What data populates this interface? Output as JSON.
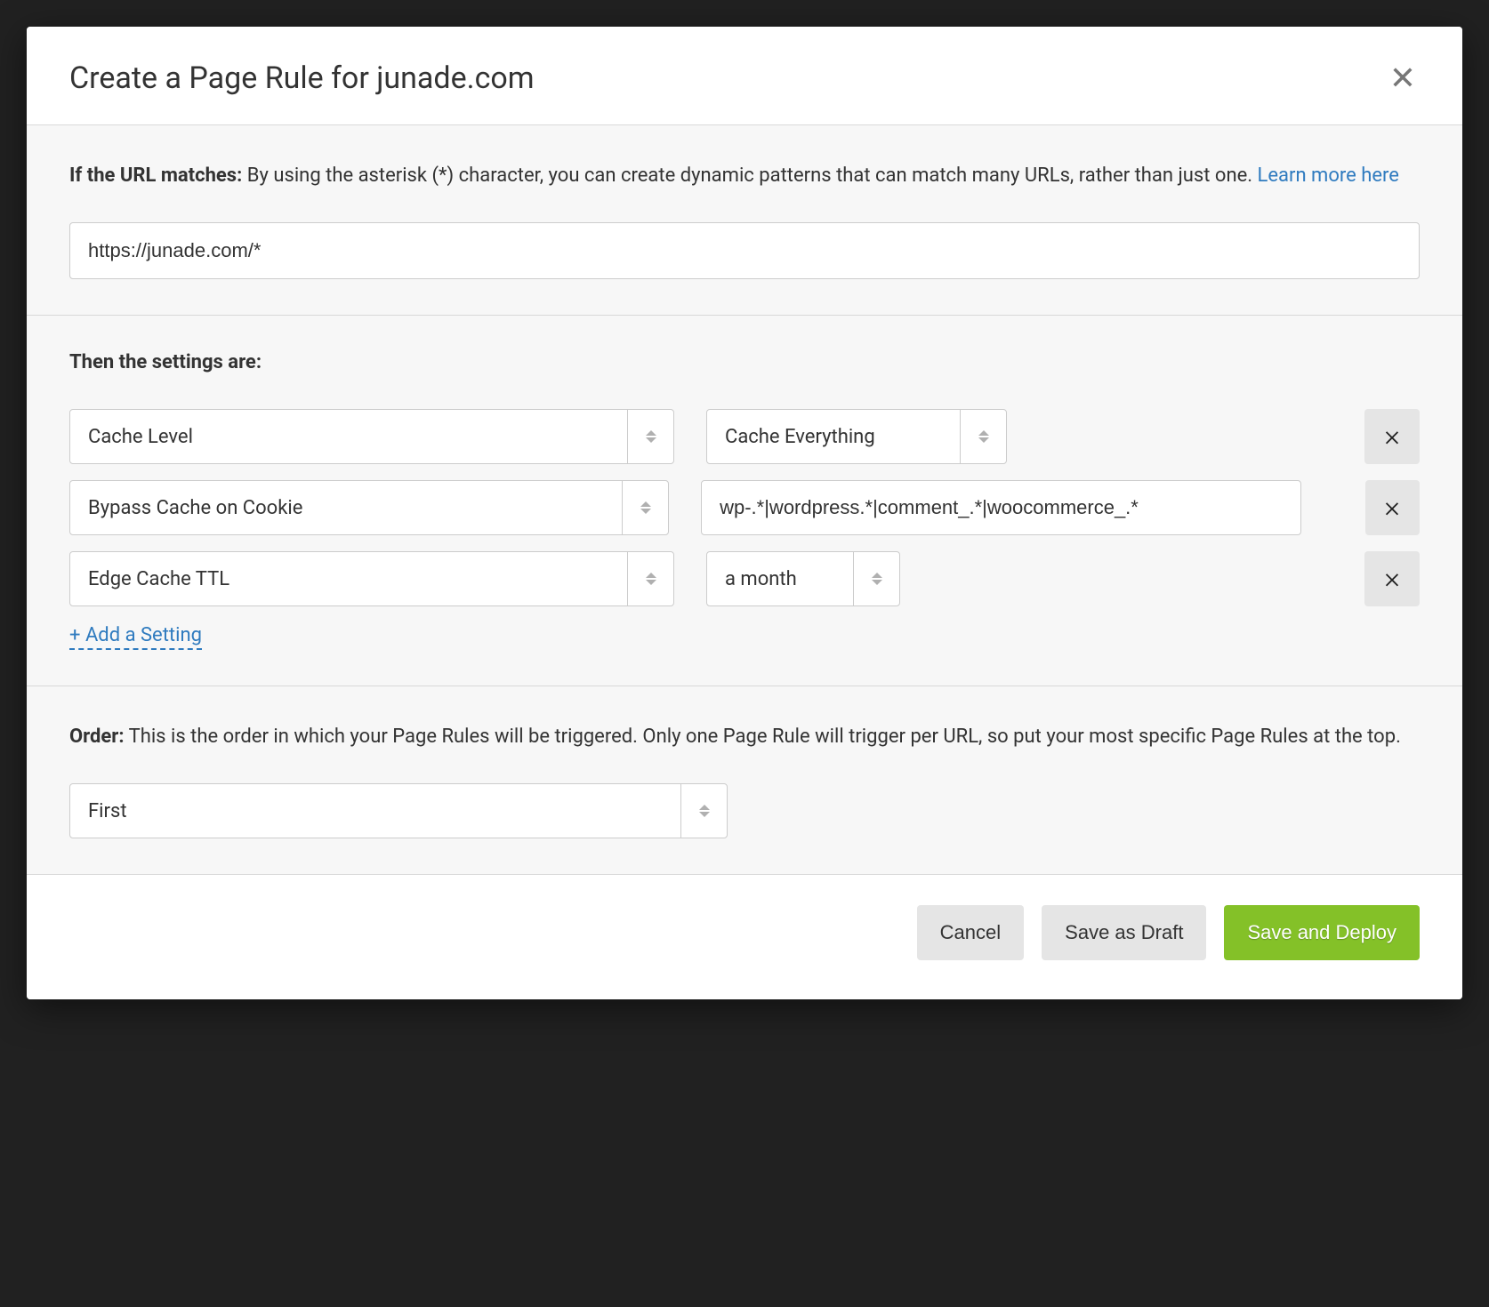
{
  "modal": {
    "title": "Create a Page Rule for junade.com",
    "close_icon": "close"
  },
  "url_section": {
    "label": "If the URL matches:",
    "description": "By using the asterisk (*) character, you can create dynamic patterns that can match many URLs, rather than just one. ",
    "learn_more": "Learn more here",
    "url_value": "https://junade.com/*"
  },
  "settings_section": {
    "title": "Then the settings are:",
    "rows": [
      {
        "key": "Cache Level",
        "value": "Cache Everything",
        "value_type": "select"
      },
      {
        "key": "Bypass Cache on Cookie",
        "value": "wp-.*|wordpress.*|comment_.*|woocommerce_.*",
        "value_type": "text"
      },
      {
        "key": "Edge Cache TTL",
        "value": "a month",
        "value_type": "select"
      }
    ],
    "add_label": "+ Add a Setting"
  },
  "order_section": {
    "label": "Order:",
    "description": "This is the order in which your Page Rules will be triggered. Only one Page Rule will trigger per URL, so put your most specific Page Rules at the top.",
    "value": "First"
  },
  "footer": {
    "cancel": "Cancel",
    "draft": "Save as Draft",
    "deploy": "Save and Deploy"
  }
}
